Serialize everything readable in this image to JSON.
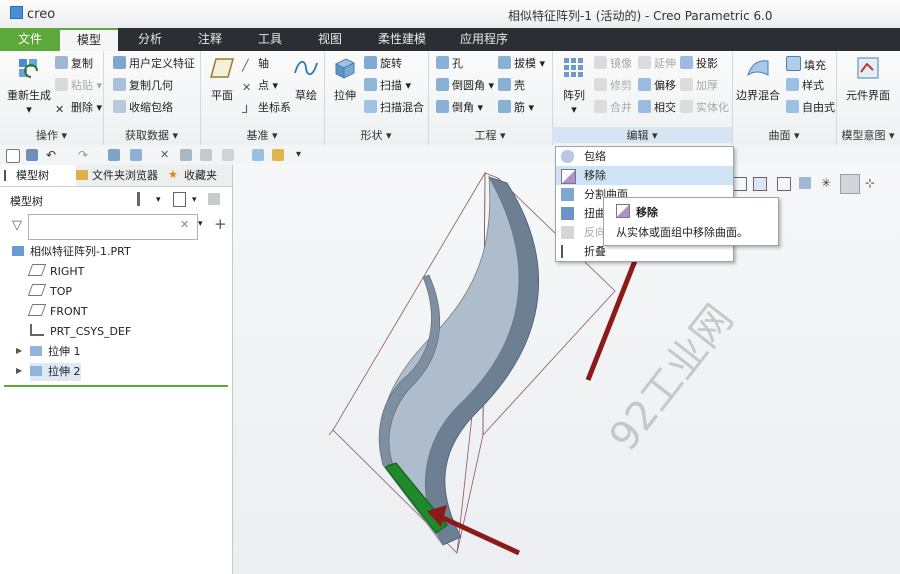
{
  "title_bar": {
    "logo": "creo",
    "title": "相似特征阵列-1 (活动的) - Creo Parametric 6.0"
  },
  "menu_tabs": [
    "文件",
    "模型",
    "分析",
    "注释",
    "工具",
    "视图",
    "柔性建模",
    "应用程序"
  ],
  "ribbon": {
    "operations": {
      "label": "操作",
      "regenerate": "重新生成",
      "copy": "复制",
      "paste": "粘贴",
      "delete": "删除"
    },
    "get_data": {
      "label": "获取数据",
      "udf": "用户定义特征",
      "copy_geom": "复制几何",
      "shrinkwrap": "收缩包络"
    },
    "datum": {
      "label": "基准",
      "plane": "平面",
      "axis": "轴",
      "point": "点",
      "csys": "坐标系",
      "sketch": "草绘"
    },
    "shapes": {
      "label": "形状",
      "extrude": "拉伸",
      "revolve": "旋转",
      "sweep": "扫描",
      "swept_blend": "扫描混合"
    },
    "engineering": {
      "label": "工程",
      "hole": "孔",
      "round": "倒圆角",
      "chamfer": "倒角",
      "draft": "拔模",
      "shell": "壳",
      "rib": "筋"
    },
    "editing": {
      "label": "编辑",
      "pattern": "阵列",
      "mirror": "镜像",
      "extend": "延伸",
      "project": "投影",
      "trim": "修剪",
      "offset": "偏移",
      "thicken": "加厚",
      "merge": "合并",
      "intersect": "相交",
      "solidify": "实体化"
    },
    "surfaces": {
      "label": "曲面",
      "boundary_blend": "边界混合",
      "fill": "填充",
      "style": "样式",
      "freestyle": "自由式"
    },
    "model_intent": {
      "label": "模型意图",
      "component_interface": "元件界面"
    }
  },
  "panel": {
    "tabs": [
      "模型树",
      "文件夹浏览器",
      "收藏夹"
    ],
    "tree_header": "模型树",
    "filter_placeholder": "",
    "tree": [
      {
        "label": "相似特征阵列-1.PRT",
        "icon": "part-icon"
      },
      {
        "label": "RIGHT",
        "icon": "datum-plane-icon"
      },
      {
        "label": "TOP",
        "icon": "datum-plane-icon"
      },
      {
        "label": "FRONT",
        "icon": "datum-plane-icon"
      },
      {
        "label": "PRT_CSYS_DEF",
        "icon": "csys-icon"
      },
      {
        "label": "拉伸 1",
        "icon": "extrude-icon"
      },
      {
        "label": "拉伸 2",
        "icon": "extrude-icon"
      }
    ]
  },
  "dropdown": {
    "items": [
      "包络",
      "移除",
      "分割曲面",
      "扭曲",
      "反向",
      "折叠"
    ],
    "highlighted": "移除"
  },
  "tooltip": {
    "title": "移除",
    "text": "从实体或面组中移除曲面。"
  },
  "watermark": "92工业网",
  "colors": {
    "file_tab": "#5ca83a",
    "menu_bar": "#2b2f33",
    "selection": "#dfe9f5",
    "highlight_face": "#1f8a2c",
    "arrow": "#8b1a1a"
  }
}
